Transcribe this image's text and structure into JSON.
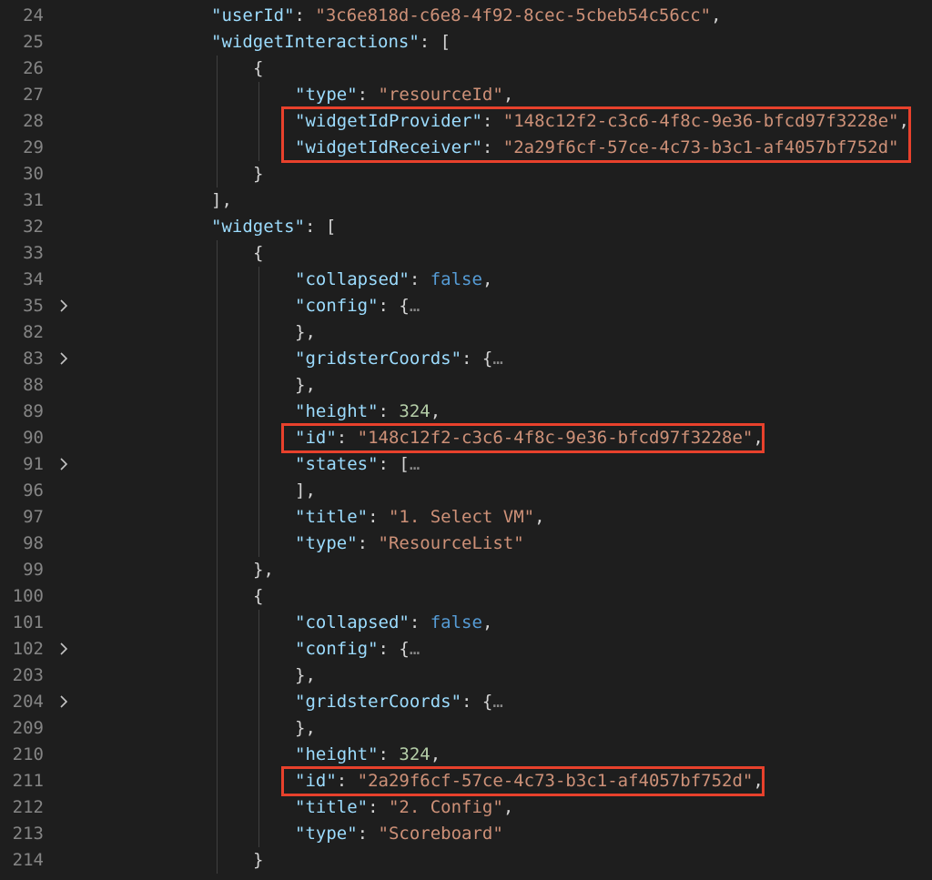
{
  "colors": {
    "background": "#1e1e1e",
    "line_number": "#858585",
    "key": "#9cdcfe",
    "string": "#ce9178",
    "number": "#b5cea8",
    "boolean": "#569cd6",
    "punctuation": "#d4d4d4",
    "highlight_box": "#e8412c"
  },
  "lines": [
    {
      "num": "24",
      "indent": 0,
      "fold": false,
      "tokens": [
        {
          "t": "k",
          "v": "\"userId\""
        },
        {
          "t": "p",
          "v": ": "
        },
        {
          "t": "s",
          "v": "\"3c6e818d-c6e8-4f92-8cec-5cbeb54c56cc\""
        },
        {
          "t": "p",
          "v": ","
        }
      ]
    },
    {
      "num": "25",
      "indent": 0,
      "fold": false,
      "tokens": [
        {
          "t": "k",
          "v": "\"widgetInteractions\""
        },
        {
          "t": "p",
          "v": ": ["
        }
      ]
    },
    {
      "num": "26",
      "indent": 1,
      "fold": false,
      "tokens": [
        {
          "t": "p",
          "v": "{"
        }
      ]
    },
    {
      "num": "27",
      "indent": 2,
      "fold": false,
      "tokens": [
        {
          "t": "k",
          "v": "\"type\""
        },
        {
          "t": "p",
          "v": ": "
        },
        {
          "t": "s",
          "v": "\"resourceId\""
        },
        {
          "t": "p",
          "v": ","
        }
      ]
    },
    {
      "num": "28",
      "indent": 2,
      "fold": false,
      "tokens": [
        {
          "t": "k",
          "v": "\"widgetIdProvider\""
        },
        {
          "t": "p",
          "v": ": "
        },
        {
          "t": "s",
          "v": "\"148c12f2-c3c6-4f8c-9e36-bfcd97f3228e\""
        },
        {
          "t": "p",
          "v": ","
        }
      ]
    },
    {
      "num": "29",
      "indent": 2,
      "fold": false,
      "tokens": [
        {
          "t": "k",
          "v": "\"widgetIdReceiver\""
        },
        {
          "t": "p",
          "v": ": "
        },
        {
          "t": "s",
          "v": "\"2a29f6cf-57ce-4c73-b3c1-af4057bf752d\""
        }
      ]
    },
    {
      "num": "30",
      "indent": 1,
      "fold": false,
      "tokens": [
        {
          "t": "p",
          "v": "}"
        }
      ]
    },
    {
      "num": "31",
      "indent": 0,
      "fold": false,
      "tokens": [
        {
          "t": "p",
          "v": "],"
        }
      ]
    },
    {
      "num": "32",
      "indent": 0,
      "fold": false,
      "tokens": [
        {
          "t": "k",
          "v": "\"widgets\""
        },
        {
          "t": "p",
          "v": ": ["
        }
      ]
    },
    {
      "num": "33",
      "indent": 1,
      "fold": false,
      "tokens": [
        {
          "t": "p",
          "v": "{"
        }
      ]
    },
    {
      "num": "34",
      "indent": 2,
      "fold": false,
      "tokens": [
        {
          "t": "k",
          "v": "\"collapsed\""
        },
        {
          "t": "p",
          "v": ": "
        },
        {
          "t": "b",
          "v": "false"
        },
        {
          "t": "p",
          "v": ","
        }
      ]
    },
    {
      "num": "35",
      "indent": 2,
      "fold": true,
      "tokens": [
        {
          "t": "k",
          "v": "\"config\""
        },
        {
          "t": "p",
          "v": ": {"
        },
        {
          "t": "e",
          "v": "…"
        }
      ]
    },
    {
      "num": "82",
      "indent": 2,
      "fold": false,
      "tokens": [
        {
          "t": "p",
          "v": "},"
        }
      ]
    },
    {
      "num": "83",
      "indent": 2,
      "fold": true,
      "tokens": [
        {
          "t": "k",
          "v": "\"gridsterCoords\""
        },
        {
          "t": "p",
          "v": ": {"
        },
        {
          "t": "e",
          "v": "…"
        }
      ]
    },
    {
      "num": "88",
      "indent": 2,
      "fold": false,
      "tokens": [
        {
          "t": "p",
          "v": "},"
        }
      ]
    },
    {
      "num": "89",
      "indent": 2,
      "fold": false,
      "tokens": [
        {
          "t": "k",
          "v": "\"height\""
        },
        {
          "t": "p",
          "v": ": "
        },
        {
          "t": "n",
          "v": "324"
        },
        {
          "t": "p",
          "v": ","
        }
      ]
    },
    {
      "num": "90",
      "indent": 2,
      "fold": false,
      "tokens": [
        {
          "t": "k",
          "v": "\"id\""
        },
        {
          "t": "p",
          "v": ": "
        },
        {
          "t": "s",
          "v": "\"148c12f2-c3c6-4f8c-9e36-bfcd97f3228e\""
        },
        {
          "t": "p",
          "v": ","
        }
      ]
    },
    {
      "num": "91",
      "indent": 2,
      "fold": true,
      "tokens": [
        {
          "t": "k",
          "v": "\"states\""
        },
        {
          "t": "p",
          "v": ": ["
        },
        {
          "t": "e",
          "v": "…"
        }
      ]
    },
    {
      "num": "96",
      "indent": 2,
      "fold": false,
      "tokens": [
        {
          "t": "p",
          "v": "],"
        }
      ]
    },
    {
      "num": "97",
      "indent": 2,
      "fold": false,
      "tokens": [
        {
          "t": "k",
          "v": "\"title\""
        },
        {
          "t": "p",
          "v": ": "
        },
        {
          "t": "s",
          "v": "\"1. Select VM\""
        },
        {
          "t": "p",
          "v": ","
        }
      ]
    },
    {
      "num": "98",
      "indent": 2,
      "fold": false,
      "tokens": [
        {
          "t": "k",
          "v": "\"type\""
        },
        {
          "t": "p",
          "v": ": "
        },
        {
          "t": "s",
          "v": "\"ResourceList\""
        }
      ]
    },
    {
      "num": "99",
      "indent": 1,
      "fold": false,
      "tokens": [
        {
          "t": "p",
          "v": "},"
        }
      ]
    },
    {
      "num": "100",
      "indent": 1,
      "fold": false,
      "tokens": [
        {
          "t": "p",
          "v": "{"
        }
      ]
    },
    {
      "num": "101",
      "indent": 2,
      "fold": false,
      "tokens": [
        {
          "t": "k",
          "v": "\"collapsed\""
        },
        {
          "t": "p",
          "v": ": "
        },
        {
          "t": "b",
          "v": "false"
        },
        {
          "t": "p",
          "v": ","
        }
      ]
    },
    {
      "num": "102",
      "indent": 2,
      "fold": true,
      "tokens": [
        {
          "t": "k",
          "v": "\"config\""
        },
        {
          "t": "p",
          "v": ": {"
        },
        {
          "t": "e",
          "v": "…"
        }
      ]
    },
    {
      "num": "203",
      "indent": 2,
      "fold": false,
      "tokens": [
        {
          "t": "p",
          "v": "},"
        }
      ]
    },
    {
      "num": "204",
      "indent": 2,
      "fold": true,
      "tokens": [
        {
          "t": "k",
          "v": "\"gridsterCoords\""
        },
        {
          "t": "p",
          "v": ": {"
        },
        {
          "t": "e",
          "v": "…"
        }
      ]
    },
    {
      "num": "209",
      "indent": 2,
      "fold": false,
      "tokens": [
        {
          "t": "p",
          "v": "},"
        }
      ]
    },
    {
      "num": "210",
      "indent": 2,
      "fold": false,
      "tokens": [
        {
          "t": "k",
          "v": "\"height\""
        },
        {
          "t": "p",
          "v": ": "
        },
        {
          "t": "n",
          "v": "324"
        },
        {
          "t": "p",
          "v": ","
        }
      ]
    },
    {
      "num": "211",
      "indent": 2,
      "fold": false,
      "tokens": [
        {
          "t": "k",
          "v": "\"id\""
        },
        {
          "t": "p",
          "v": ": "
        },
        {
          "t": "s",
          "v": "\"2a29f6cf-57ce-4c73-b3c1-af4057bf752d\""
        },
        {
          "t": "p",
          "v": ","
        }
      ]
    },
    {
      "num": "212",
      "indent": 2,
      "fold": false,
      "tokens": [
        {
          "t": "k",
          "v": "\"title\""
        },
        {
          "t": "p",
          "v": ": "
        },
        {
          "t": "s",
          "v": "\"2. Config\""
        },
        {
          "t": "p",
          "v": ","
        }
      ]
    },
    {
      "num": "213",
      "indent": 2,
      "fold": false,
      "tokens": [
        {
          "t": "k",
          "v": "\"type\""
        },
        {
          "t": "p",
          "v": ": "
        },
        {
          "t": "s",
          "v": "\"Scoreboard\""
        }
      ]
    },
    {
      "num": "214",
      "indent": 1,
      "fold": false,
      "tokens": [
        {
          "t": "p",
          "v": "}"
        }
      ]
    }
  ],
  "highlights": [
    {
      "name": "highlight-widget-id-pair",
      "lines": [
        "28",
        "29"
      ]
    },
    {
      "name": "highlight-widget-1-id",
      "lines": [
        "90"
      ]
    },
    {
      "name": "highlight-widget-2-id",
      "lines": [
        "211"
      ]
    }
  ]
}
